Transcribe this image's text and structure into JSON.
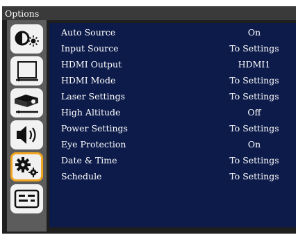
{
  "window": {
    "title": "Options"
  },
  "sidebar": {
    "items": [
      {
        "icon": "picture-icon"
      },
      {
        "icon": "display-icon"
      },
      {
        "icon": "setup-icon"
      },
      {
        "icon": "audio-icon"
      },
      {
        "icon": "options-gear-icon",
        "selected": true
      },
      {
        "icon": "network-icon"
      }
    ]
  },
  "menu": {
    "rows": [
      {
        "label": "Auto Source",
        "value": "On"
      },
      {
        "label": "Input Source",
        "value": "To Settings"
      },
      {
        "label": "HDMI Output",
        "value": "HDMI1"
      },
      {
        "label": "HDMI Mode",
        "value": "To Settings"
      },
      {
        "label": "Laser Settings",
        "value": "To Settings"
      },
      {
        "label": "High Altitude",
        "value": "Off"
      },
      {
        "label": "Power Settings",
        "value": "To Settings"
      },
      {
        "label": "Eye Protection",
        "value": "On"
      },
      {
        "label": "Date & Time",
        "value": "To Settings"
      },
      {
        "label": "Schedule",
        "value": "To Settings"
      }
    ]
  },
  "colors": {
    "accent": "#f2a51f",
    "content_bg": "#0d1b4a",
    "sidebar_bg": "#5c5c5c"
  }
}
